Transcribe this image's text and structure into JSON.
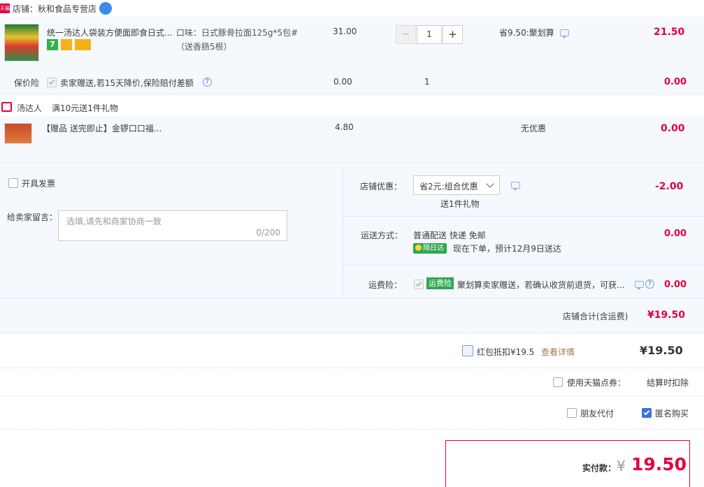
{
  "shop": {
    "label": "店铺：秋和食品专营店",
    "tmall_badge": "天猫",
    "ww_icon": "wangwang-icon"
  },
  "item1": {
    "title": "统一汤达人袋装方便面即食日式...",
    "sku": "口味：日式豚骨拉面125g*5包#",
    "sku2": "（送香肠5根）",
    "price": "31.00",
    "qty_minus": "−",
    "qty": "1",
    "qty_plus": "+",
    "promo": "省9.50:聚划算",
    "total": "21.50",
    "badge_7": "7"
  },
  "insurance": {
    "label": "保价险",
    "desc": "卖家赠送,若15天降价,保险赔付差额",
    "price": "0.00",
    "qty": "1",
    "total": "0.00"
  },
  "gift_header": {
    "brand": "汤达人",
    "rule": "满10元送1件礼物"
  },
  "gift_item": {
    "title": "【赠品 送完即止】金锣口口福...",
    "price": "4.80",
    "promo": "无优惠",
    "total": "0.00"
  },
  "invoice": {
    "label": "开具发票"
  },
  "message": {
    "label": "给卖家留言：",
    "placeholder": "选填,请先和商家协商一致",
    "counter": "0/200"
  },
  "shop_discount": {
    "label": "店铺优惠：",
    "selected": "省2元:组合优惠",
    "gift_note": "送1件礼物",
    "amount": "-2.00"
  },
  "shipping": {
    "label": "运送方式：",
    "method": "普通配送 快递 免邮",
    "badge": "隔日达",
    "eta": "现在下单，预计12月9日送达",
    "amount": "0.00"
  },
  "freight_ins": {
    "label": "运费险：",
    "badge": "运费险",
    "desc": "聚划算卖家赠送，若确认收货前退货，可获...",
    "amount": "0.00"
  },
  "shop_total": {
    "label": "店铺合计(含运费)",
    "amount": "¥19.50"
  },
  "redpacket": {
    "label": "红包抵扣¥19.5",
    "link": "查看详情",
    "amount": "¥19.50"
  },
  "tmall_points": {
    "label": "使用天猫点券：",
    "note": "结算时扣除"
  },
  "friend_pay": {
    "label": "朋友代付"
  },
  "anon": {
    "label": "匿名购买"
  },
  "actual": {
    "label": "实付款：",
    "currency": "¥",
    "amount": "19.50"
  },
  "colors": {
    "accent_red": "#e4003f",
    "link_blue": "#3b74d8",
    "panel_bg": "#f5f8fd"
  }
}
